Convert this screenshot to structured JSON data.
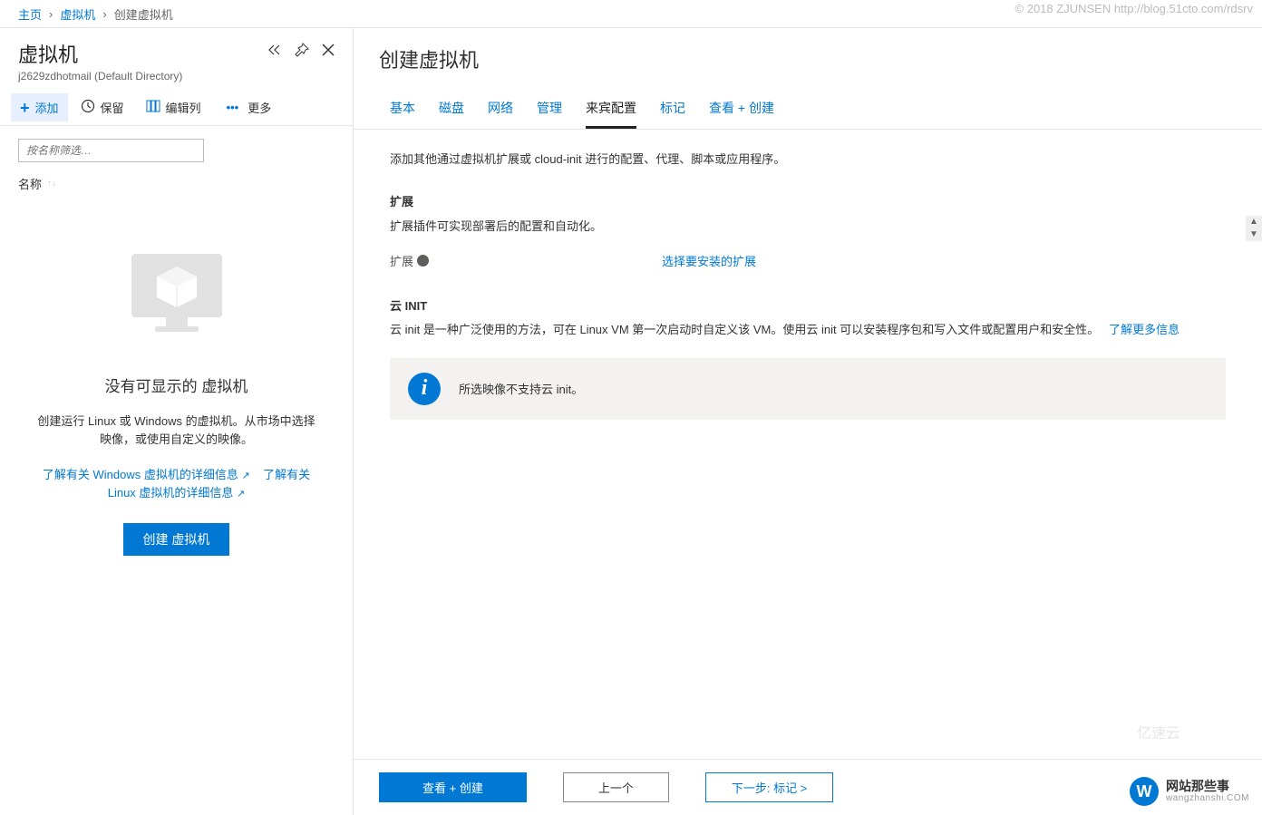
{
  "breadcrumb": {
    "home": "主页",
    "vms": "虚拟机",
    "current": "创建虚拟机"
  },
  "watermark_top": "© 2018 ZJUNSEN http://blog.51cto.com/rdsrv",
  "left": {
    "title": "虚拟机",
    "subtitle": "j2629zdhotmail (Default Directory)",
    "toolbar": {
      "add": "添加",
      "keep": "保留",
      "edit_columns": "编辑列",
      "more": "更多"
    },
    "filter_placeholder": "按名称筛选…",
    "name_column": "名称",
    "empty": {
      "title": "没有可显示的 虚拟机",
      "desc": "创建运行 Linux 或 Windows 的虚拟机。从市场中选择映像，或使用自定义的映像。",
      "link_windows": "了解有关 Windows 虚拟机的详细信息",
      "link_linux_prefix": "了解有关 Linux 虚拟机的详细信息",
      "button": "创建 虚拟机"
    }
  },
  "right": {
    "title": "创建虚拟机",
    "tabs": {
      "basic": "基本",
      "disks": "磁盘",
      "network": "网络",
      "management": "管理",
      "guest": "来宾配置",
      "tags": "标记",
      "review": "查看 + 创建"
    },
    "intro": "添加其他通过虚拟机扩展或 cloud-init 进行的配置、代理、脚本或应用程序。",
    "ext_title": "扩展",
    "ext_desc": "扩展插件可实现部署后的配置和自动化。",
    "ext_label": "扩展",
    "ext_link": "选择要安装的扩展",
    "cloudinit_title": "云 INIT",
    "cloudinit_desc": "云 init 是一种广泛使用的方法，可在 Linux VM 第一次启动时自定义该 VM。使用云 init 可以安装程序包和写入文件或配置用户和安全性。",
    "cloudinit_link": "了解更多信息",
    "banner_text": "所选映像不支持云 init。"
  },
  "footer": {
    "review": "查看 + 创建",
    "previous": "上一个",
    "next": "下一步: 标记 >"
  },
  "wm_bottom": {
    "cn": "网站那些事",
    "url": "wangzhanshi.COM"
  },
  "wm_faint": "亿速云"
}
